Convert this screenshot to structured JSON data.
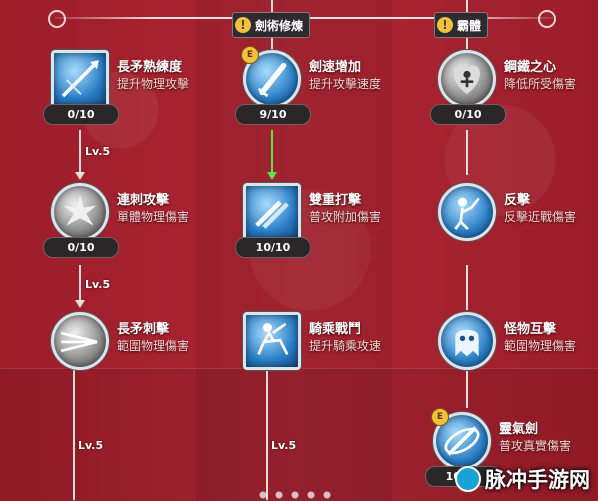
{
  "tree_headers": [
    {
      "label": "劍術修煉"
    },
    {
      "label": "霸體"
    }
  ],
  "skills": [
    {
      "name": "長矛熟練度",
      "desc": "提升物理攻擊",
      "level": "0/10",
      "icon": "spear-mastery-icon"
    },
    {
      "name": "劍速增加",
      "desc": "提升攻擊速度",
      "level": "9/10",
      "icon": "sword-speed-icon"
    },
    {
      "name": "鋼鐵之心",
      "desc": "降低所受傷害",
      "level": "0/10",
      "icon": "iron-heart-icon"
    },
    {
      "name": "連刺攻擊",
      "desc": "單體物理傷害",
      "level": "0/10",
      "icon": "combo-thrust-icon"
    },
    {
      "name": "雙重打擊",
      "desc": "普攻附加傷害",
      "level": "10/10",
      "icon": "double-strike-icon"
    },
    {
      "name": "反擊",
      "desc": "反擊近戰傷害",
      "level": "0/10",
      "icon": "counter-attack-icon"
    },
    {
      "name": "長矛刺擊",
      "desc": "範圍物理傷害",
      "level": "",
      "icon": "spear-thrust-icon"
    },
    {
      "name": "騎乘戰鬥",
      "desc": "提升騎乘攻速",
      "level": "",
      "icon": "mounted-combat-icon"
    },
    {
      "name": "怪物互擊",
      "desc": "範圍物理傷害",
      "level": "",
      "icon": "monster-clash-icon"
    },
    {
      "name": "靈氣劍",
      "desc": "普攻真實傷害",
      "level": "10/10",
      "icon": "aura-sword-icon"
    }
  ],
  "badges": {
    "e": "E",
    "excl": "!"
  },
  "level_requirements": [
    "Lv.5",
    "Lv.5",
    "Lv.5",
    "Lv.5"
  ],
  "watermark": {
    "text": "脉冲手游网"
  },
  "colors": {
    "background": "#a51f2d",
    "unlocked_line": "#5fe34c",
    "badge": "#f2c23d"
  }
}
